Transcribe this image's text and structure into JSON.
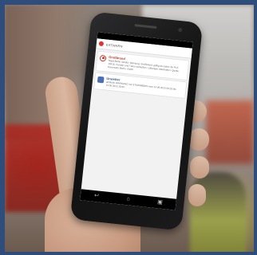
{
  "app": {
    "title": "KATWARN"
  },
  "warnings": [
    {
      "title": "Großbrand",
      "text": "Stadt Berlin meldet: Warnung. Großbrand, gültig ab sofort, für PLZ 10415, Fenster und Türen schließen, Lüftungen abschalten. Quelle: Feuerwehr Berlin. 03/06",
      "color": "#d23a2c"
    },
    {
      "title": "Unwetter",
      "text": "amtliche WARNUNG vor STURMBÖEN vom 14.06.2013 09:25 bis 14.06.2013 15:00",
      "color": "#3b5998"
    }
  ],
  "navigation": {
    "back_icon": "back-arrow-icon",
    "home_icon": "home-icon",
    "recent_icon": "recent-apps-icon"
  }
}
